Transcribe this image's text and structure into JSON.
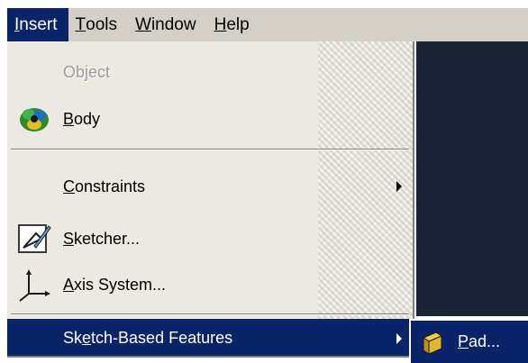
{
  "menubar": {
    "items": [
      {
        "mnemonic": "I",
        "rest": "nsert"
      },
      {
        "mnemonic": "T",
        "rest": "ools"
      },
      {
        "mnemonic": "W",
        "rest": "indow"
      },
      {
        "mnemonic": "H",
        "rest": "elp"
      }
    ],
    "active_item": "Insert"
  },
  "insert_menu": {
    "items": [
      {
        "text": "Object",
        "state": "disabled"
      },
      {
        "mnemonic": "B",
        "rest": "ody",
        "icon": "body-icon"
      },
      {
        "mnemonic": "C",
        "rest": "onstraints",
        "has_submenu": true
      },
      {
        "mnemonic": "S",
        "rest": "ketcher...",
        "icon": "sketcher-icon"
      },
      {
        "mnemonic": "A",
        "rest": "xis System...",
        "icon": "axis-system-icon"
      },
      {
        "pre": "Sk",
        "mnemonic": "e",
        "rest": "tch-Based Features",
        "has_submenu": true,
        "state": "highlighted"
      }
    ]
  },
  "submenu": {
    "items": [
      {
        "mnemonic": "P",
        "rest": "ad...",
        "icon": "pad-icon"
      }
    ]
  },
  "colors": {
    "highlight": "#0a246a",
    "menu_bg": "#ece9e2",
    "menubar_bg": "#d4d0c8",
    "app_bg": "#1c2438"
  }
}
